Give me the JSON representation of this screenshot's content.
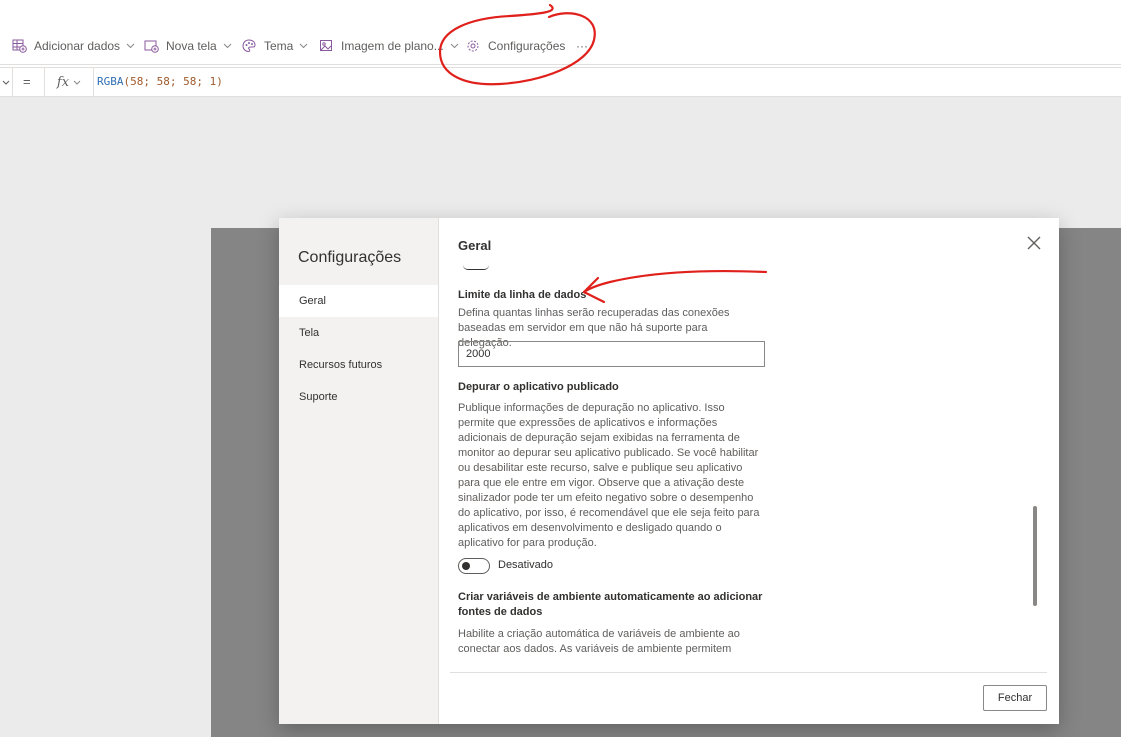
{
  "toolbar": {
    "add_data": "Adicionar dados",
    "new_screen": "Nova tela",
    "theme": "Tema",
    "background_image": "Imagem de plano...",
    "settings": "Configurações",
    "more": "···"
  },
  "formula": {
    "equals": "=",
    "fx": "fx",
    "function_name": "RGBA",
    "args": "(58; 58; 58; 1)"
  },
  "dialog": {
    "sidebar_title": "Configurações",
    "nav": [
      "Geral",
      "Tela",
      "Recursos futuros",
      "Suporte"
    ],
    "active_nav": "Geral",
    "panel_title": "Geral",
    "row_limit": {
      "title": "Limite da linha de dados",
      "description": "Defina quantas linhas serão recuperadas das conexões baseadas em servidor em que não há suporte para delegação.",
      "value": "2000"
    },
    "debug": {
      "title": "Depurar o aplicativo publicado",
      "description": "Publique informações de depuração no aplicativo. Isso permite que expressões de aplicativos e informações adicionais de depuração sejam exibidas na ferramenta de monitor ao depurar seu aplicativo publicado. Se você habilitar ou desabilitar este recurso, salve e publique seu aplicativo para que ele entre em vigor. Observe que a ativação deste sinalizador pode ter um efeito negativo sobre o desempenho do aplicativo, por isso, é recomendável que ele seja feito para aplicativos em desenvolvimento e desligado quando o aplicativo for para produção.",
      "toggle_label": "Desativado",
      "toggle_on": false
    },
    "env_vars": {
      "title": "Criar variáveis de ambiente automaticamente ao adicionar fontes de dados",
      "description": "Habilite a criação automática de variáveis de ambiente ao conectar aos dados. As variáveis de ambiente permitem"
    },
    "close_button": "Fechar"
  },
  "colors": {
    "annotation_red": "#e0201b",
    "icon_accent": "#8a5a9e",
    "overlay_gray": "#858585"
  }
}
